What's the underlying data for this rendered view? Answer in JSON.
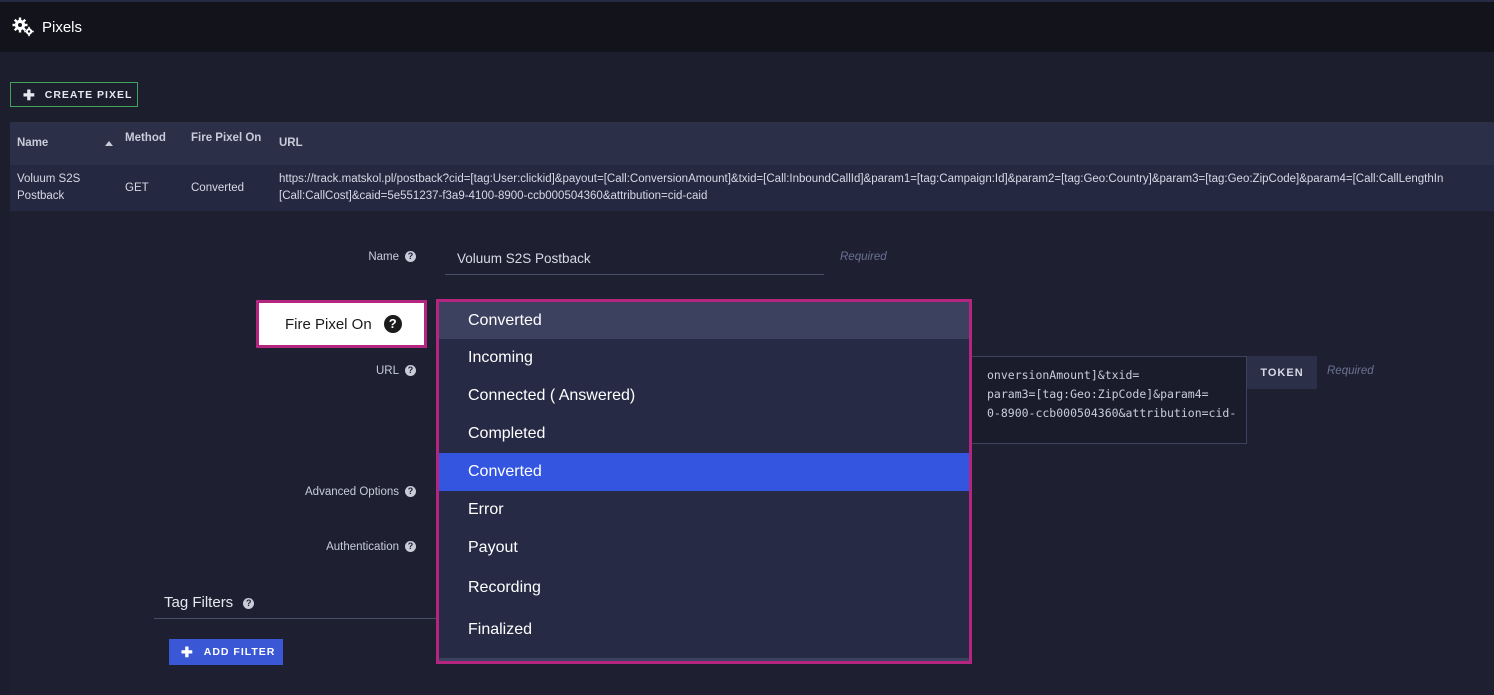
{
  "header": {
    "title": "Pixels",
    "icon": "gears-icon"
  },
  "toolbar": {
    "create_label": "CREATE PIXEL"
  },
  "table": {
    "columns": [
      "Name",
      "Method",
      "Fire Pixel On",
      "URL"
    ],
    "sort_column": "Name",
    "rows": [
      {
        "name_line1": "Voluum S2S",
        "name_line2": "Postback",
        "method": "GET",
        "fire_on": "Converted",
        "url_line1": "https://track.matskol.pl/postback?cid=[tag:User:clickid]&payout=[Call:ConversionAmount]&txid=[Call:InboundCallId]&param1=[tag:Campaign:Id]&param2=[tag:Geo:Country]&param3=[tag:Geo:ZipCode]&param4=[Call:CallLengthIn",
        "url_line2": "[Call:CallCost]&caid=5e551237-f3a9-4100-8900-ccb000504360&attribution=cid-caid"
      }
    ]
  },
  "form": {
    "name_label": "Name",
    "name_value": "Voluum S2S Postback",
    "name_required": "Required",
    "fire_label": "Fire Pixel On",
    "url_label": "URL",
    "url_lines": [
      "onversionAmount]&txid=",
      "param3=[tag:Geo:ZipCode]&param4=",
      "0-8900-ccb000504360&attribution=cid-"
    ],
    "token_label": "TOKEN",
    "url_required": "Required",
    "advanced_label": "Advanced Options",
    "auth_label": "Authentication",
    "tag_filters_title": "Tag Filters",
    "add_filter_label": "ADD FILTER"
  },
  "dropdown": {
    "selected": "Converted",
    "highlighted": "Converted",
    "options": [
      "Incoming",
      "Connected ( Answered)",
      "Completed",
      "Converted",
      "Error",
      "Payout",
      "Recording",
      "Finalized"
    ]
  }
}
